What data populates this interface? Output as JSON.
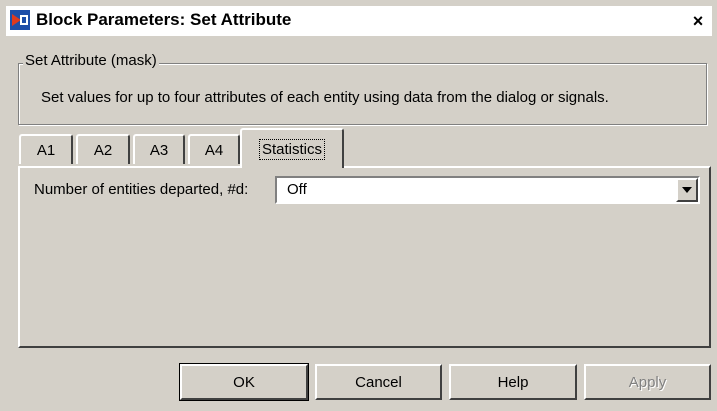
{
  "window": {
    "title": "Block Parameters: Set Attribute",
    "close_glyph": "×"
  },
  "mask": {
    "legend": "Set Attribute (mask)",
    "description": "Set values for up to four attributes of each entity using data from the dialog or signals."
  },
  "tabs": [
    {
      "label": "A1",
      "active": false
    },
    {
      "label": "A2",
      "active": false
    },
    {
      "label": "A3",
      "active": false
    },
    {
      "label": "A4",
      "active": false
    },
    {
      "label": "Statistics",
      "active": true
    }
  ],
  "statistics": {
    "param_label": "Number of entities departed, #d:",
    "param_value": "Off"
  },
  "buttons": {
    "ok": "OK",
    "cancel": "Cancel",
    "help": "Help",
    "apply": "Apply"
  },
  "icons": {
    "app": "simulink-block-icon",
    "close": "close-icon",
    "dropdown": "chevron-down-icon"
  }
}
